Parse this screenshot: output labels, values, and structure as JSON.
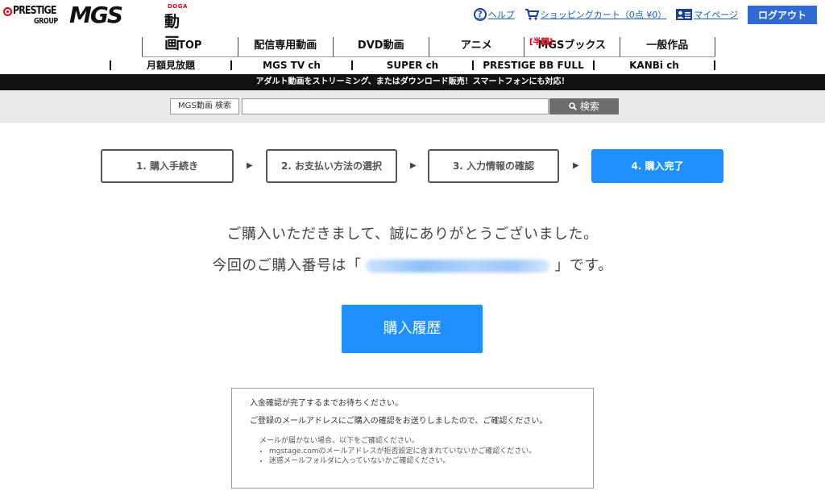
{
  "brand": {
    "prestige_top": "PRESTIGE",
    "prestige_bottom": "GROUP",
    "mgs": "MGS",
    "doga_en": "DOGA",
    "doga_jp": "動画"
  },
  "header_links": {
    "help": "ヘルプ",
    "cart": "ショッピングカート（0点 ¥0）",
    "mypage": "マイページ",
    "logout": "ログアウト"
  },
  "nav_primary": [
    {
      "label": "TOP"
    },
    {
      "label": "配信専用動画"
    },
    {
      "label": "DVD動画"
    },
    {
      "label": "アニメ"
    },
    {
      "label": "MGSブックス",
      "badge": "[半額]"
    },
    {
      "label": "一般作品"
    }
  ],
  "nav_secondary": [
    {
      "label": "月額見放題"
    },
    {
      "label": "MGS TV ch"
    },
    {
      "label": "SUPER ch"
    },
    {
      "label": "PRESTIGE BB FULL"
    },
    {
      "label": "KANBi ch"
    }
  ],
  "banner": "アダルト動画をストリーミング、またはダウンロード販売！スマートフォンにも対応！",
  "search": {
    "label": "MGS動画 検索",
    "value": "",
    "button": "検索"
  },
  "steps": [
    {
      "label": "1. 購入手続き",
      "active": false
    },
    {
      "label": "2. お支払い方法の選択",
      "active": false
    },
    {
      "label": "3. 入力情報の確認",
      "active": false
    },
    {
      "label": "4. 購入完了",
      "active": true
    }
  ],
  "step_arrow": "▶",
  "message": {
    "thanks": "ご購入いただきまして、誠にありがとうございました。",
    "order_prefix": "今回のご購入番号は「",
    "order_suffix": "」です。"
  },
  "history_button": "購入履歴",
  "notice": {
    "line1": "入金確認が完了するまでお待ちください。",
    "line2": "ご登録のメールアドレスにご購入の確認をお送りしましたので、ご確認ください。",
    "sub_heading": "メールが届かない場合、以下をご確認ください。",
    "items": [
      "mgstage.comのメールアドレスが拒否設定に含まれていないかご確認ください。",
      "迷惑メールフォルダに入っていないかご確認ください。"
    ]
  },
  "colors": {
    "accent": "#1e90ff",
    "logout": "#2f6bd2",
    "brand_red": "#e60012",
    "link": "#1a5fb4"
  }
}
